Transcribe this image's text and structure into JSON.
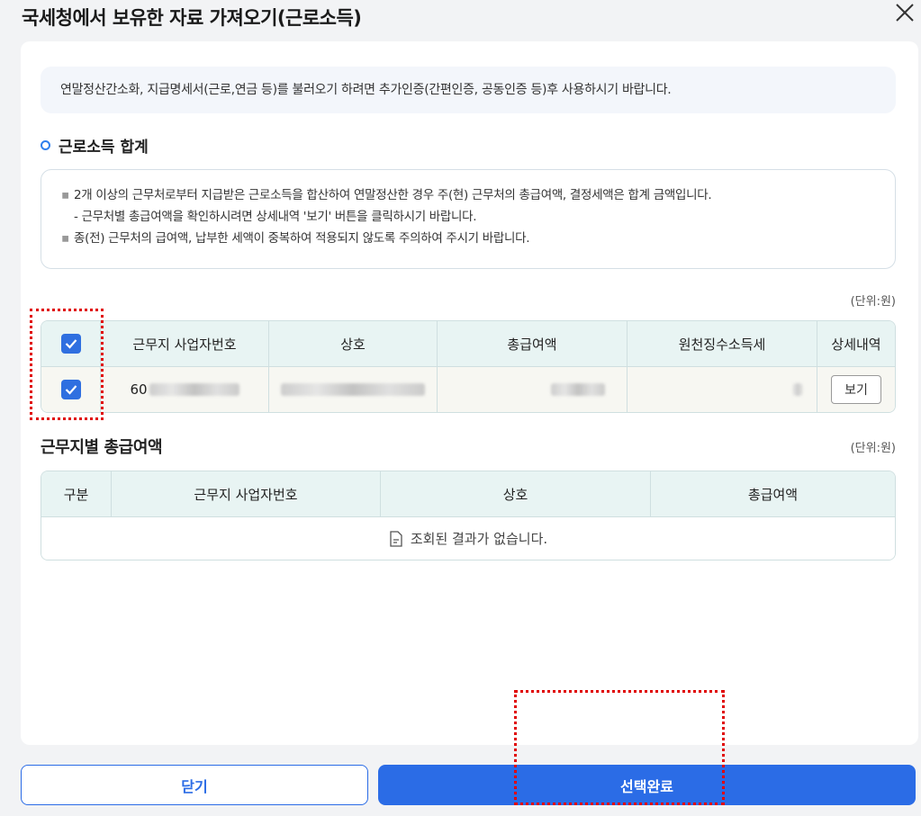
{
  "modal": {
    "title": "국세청에서 보유한 자료 가져오기(근로소득)",
    "notice": "연말정산간소화, 지급명세서(근로,연금 등)를 불러오기 하려면 추가인증(간편인증, 공동인증 등)후 사용하시기 바랍니다."
  },
  "section1": {
    "title": "근로소득 합계",
    "info": [
      "2개 이상의 근무처로부터 지급받은 근로소득을 합산하여 연말정산한 경우 주(현) 근무처의 총급여액, 결정세액은 합계 금액입니다.",
      "- 근무처별 총급여액을 확인하시려면 상세내역 '보기' 버튼을 클릭하시기 바랍니다.",
      "종(전) 근무처의 급여액, 납부한 세액이 중복하여 적용되지 않도록 주의하여 주시기 바랍니다."
    ],
    "unit": "(단위:원)",
    "headers": [
      "근무지 사업자번호",
      "상호",
      "총급여액",
      "원천징수소득세",
      "상세내역"
    ],
    "row": {
      "bizno_prefix": "60",
      "checked": true,
      "view_label": "보기"
    }
  },
  "section2": {
    "title": "근무지별 총급여액",
    "unit": "(단위:원)",
    "headers": [
      "구분",
      "근무지 사업자번호",
      "상호",
      "총급여액"
    ],
    "empty": "조회된 결과가 없습니다."
  },
  "footer": {
    "close_label": "닫기",
    "done_label": "선택완료"
  },
  "colors": {
    "accent": "#2b6ce6",
    "highlight": "#e00000"
  }
}
